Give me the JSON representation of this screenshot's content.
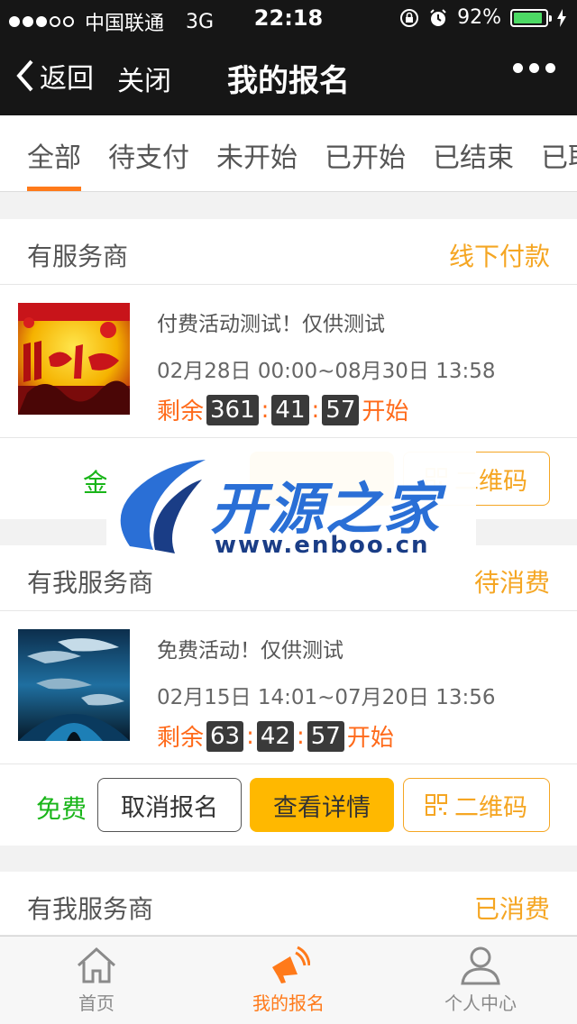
{
  "status_bar": {
    "carrier": "中国联通",
    "network": "3G",
    "time": "22:18",
    "battery": "92%",
    "battery_level": 0.92
  },
  "nav": {
    "back_label": "返回",
    "close_label": "关闭",
    "title": "我的报名"
  },
  "tabs": [
    "全部",
    "待支付",
    "未开始",
    "已开始",
    "已结束",
    "已取"
  ],
  "active_tab_index": 0,
  "cards": [
    {
      "provider": "有服务商",
      "state": "线下付款",
      "event_name": "付费活动测试！仅供测试",
      "date_range": "02月28日 00:00~08月30日 13:58",
      "countdown_prefix": "剩余",
      "countdown": [
        "361",
        "41",
        "57"
      ],
      "countdown_suffix": "开始",
      "price": "金",
      "qr_label": "二维码"
    },
    {
      "provider": "有我服务商",
      "state": "待消费",
      "event_name": "免费活动！仅供测试",
      "date_range": "02月15日 14:01~07月20日 13:56",
      "countdown_prefix": "剩余",
      "countdown": [
        "63",
        "42",
        "57"
      ],
      "countdown_suffix": "开始",
      "price": "免费",
      "cancel_label": "取消报名",
      "detail_label": "查看详情",
      "qr_label": "二维码"
    },
    {
      "provider": "有我服务商",
      "state": "已消费"
    }
  ],
  "watermark": {
    "title": "开源之家",
    "url": "www.enboo.cn"
  },
  "tabbar": {
    "items": [
      "首页",
      "我的报名",
      "个人中心"
    ],
    "active_index": 1
  },
  "colors": {
    "accent": "#ff7a1a",
    "state": "#f5a623",
    "primary_button": "#ffb800",
    "free_price": "#19b519",
    "header_bg": "#161616"
  }
}
